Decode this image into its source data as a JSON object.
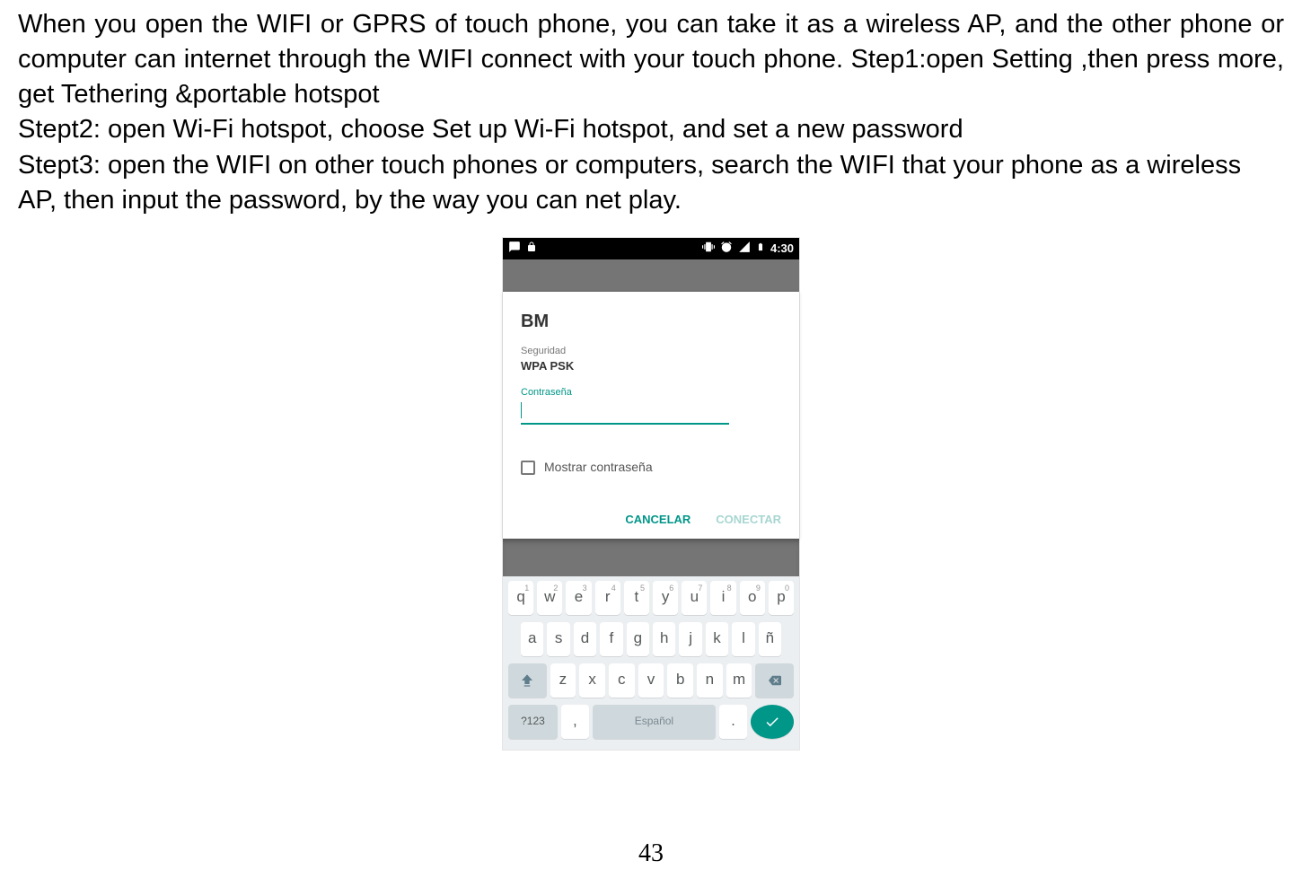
{
  "doc": {
    "intro": "When you open the WIFI or GPRS of touch phone, you can take it as a wireless AP, and the other phone or computer can internet through the WIFI connect with your touch phone. Step1:open Setting ,then press more, get Tethering &portable hotspot",
    "step2": "Stept2: open Wi-Fi hotspot, choose Set up Wi-Fi hotspot, and set a new password",
    "step3": "Stept3: open the WIFI on other touch phones or computers, search the WIFI that your phone as a wireless AP, then input the password, by the way you can net play."
  },
  "statusbar": {
    "time": "4:30"
  },
  "dialog": {
    "title": "BM",
    "security_label": "Seguridad",
    "security_value": "WPA PSK",
    "password_label": "Contraseña",
    "show_pw": "Mostrar contraseña",
    "cancel": "CANCELAR",
    "connect": "CONECTAR"
  },
  "keyboard": {
    "row1": [
      {
        "k": "q",
        "n": "1"
      },
      {
        "k": "w",
        "n": "2"
      },
      {
        "k": "e",
        "n": "3"
      },
      {
        "k": "r",
        "n": "4"
      },
      {
        "k": "t",
        "n": "5"
      },
      {
        "k": "y",
        "n": "6"
      },
      {
        "k": "u",
        "n": "7"
      },
      {
        "k": "i",
        "n": "8"
      },
      {
        "k": "o",
        "n": "9"
      },
      {
        "k": "p",
        "n": "0"
      }
    ],
    "row2": [
      "a",
      "s",
      "d",
      "f",
      "g",
      "h",
      "j",
      "k",
      "l",
      "ñ"
    ],
    "row3": [
      "z",
      "x",
      "c",
      "v",
      "b",
      "n",
      "m"
    ],
    "sym": "?123",
    "space": "Español"
  },
  "page_number": "43"
}
